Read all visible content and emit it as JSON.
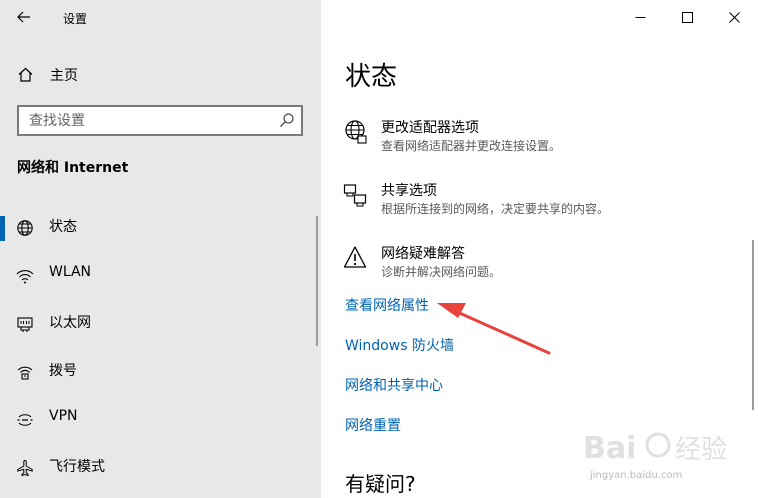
{
  "window": {
    "title": "设置",
    "controls": [
      "minimize",
      "maximize",
      "close"
    ]
  },
  "sidebar": {
    "home_label": "主页",
    "search_placeholder": "查找设置",
    "section_heading": "网络和 Internet",
    "items": [
      {
        "label": "状态",
        "icon": "globe-icon",
        "selected": true
      },
      {
        "label": "WLAN",
        "icon": "wifi-icon",
        "selected": false
      },
      {
        "label": "以太网",
        "icon": "ethernet-icon",
        "selected": false
      },
      {
        "label": "拨号",
        "icon": "dialup-icon",
        "selected": false
      },
      {
        "label": "VPN",
        "icon": "vpn-icon",
        "selected": false
      },
      {
        "label": "飞行模式",
        "icon": "airplane-icon",
        "selected": false
      }
    ]
  },
  "main": {
    "page_title": "状态",
    "settings": [
      {
        "title": "更改适配器选项",
        "desc": "查看网络适配器并更改连接设置。",
        "icon": "adapter-globe-icon"
      },
      {
        "title": "共享选项",
        "desc": "根据所连接到的网络，决定要共享的内容。",
        "icon": "sharing-icon"
      },
      {
        "title": "网络疑难解答",
        "desc": "诊断并解决网络问题。",
        "icon": "warning-icon"
      }
    ],
    "links": [
      {
        "label": "查看网络属性"
      },
      {
        "label": "Windows 防火墙"
      },
      {
        "label": "网络和共享中心"
      },
      {
        "label": "网络重置"
      }
    ],
    "question_heading": "有疑问?"
  },
  "colors": {
    "accent": "#0063b1",
    "annotation": "#e8423c",
    "sidebar_bg": "#e8e8e8"
  },
  "watermark": {
    "text": "Bai经验",
    "sub": "jingyan.baidu.com"
  }
}
